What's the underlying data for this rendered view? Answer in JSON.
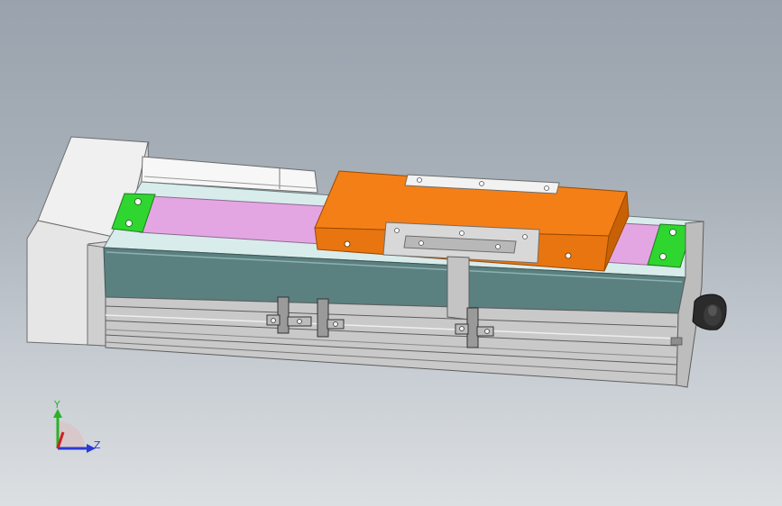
{
  "colors": {
    "carriage": "#f57f17",
    "end_pad": "#2fd62f",
    "belt": "#e3a6e3",
    "cover": "#5b8080",
    "motor": "#e4e4e4",
    "rail": "#cfcfcf",
    "x_axis": "#ce2020",
    "y_axis": "#29b229",
    "z_axis": "#2a3bd4"
  },
  "triad": {
    "y_label": "Y",
    "z_label": "Z"
  }
}
